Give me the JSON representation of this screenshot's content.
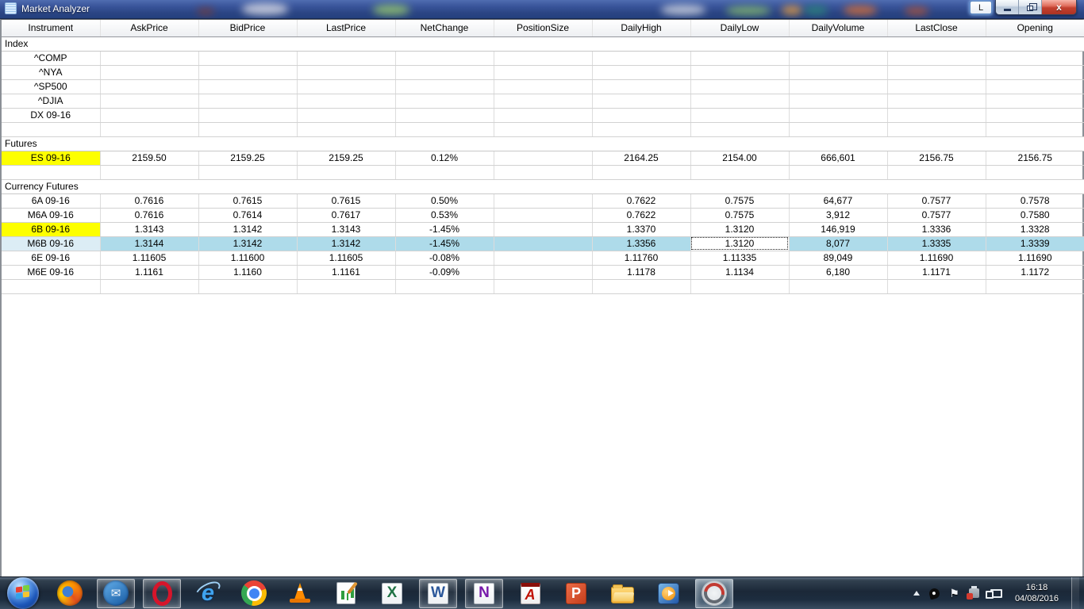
{
  "window": {
    "title": "Market Analyzer",
    "l_button_label": "L",
    "close_glyph": "x"
  },
  "colors": {
    "highlight_yellow": "#fdff00",
    "selected_row": "#aedbea",
    "selected_instrument": "#dcedf5",
    "titlebar_blue": "#33518f"
  },
  "table": {
    "columns": [
      "Instrument",
      "AskPrice",
      "BidPrice",
      "LastPrice",
      "NetChange",
      "PositionSize",
      "DailyHigh",
      "DailyLow",
      "DailyVolume",
      "LastClose",
      "Opening"
    ],
    "groups": [
      {
        "label": "Index",
        "rows": [
          {
            "instrument": "^COMP",
            "cells": [
              "",
              "",
              "",
              "",
              "",
              "",
              "",
              "",
              "",
              ""
            ]
          },
          {
            "instrument": "^NYA",
            "cells": [
              "",
              "",
              "",
              "",
              "",
              "",
              "",
              "",
              "",
              ""
            ]
          },
          {
            "instrument": "^SP500",
            "cells": [
              "",
              "",
              "",
              "",
              "",
              "",
              "",
              "",
              "",
              ""
            ]
          },
          {
            "instrument": "^DJIA",
            "cells": [
              "",
              "",
              "",
              "",
              "",
              "",
              "",
              "",
              "",
              ""
            ]
          },
          {
            "instrument": "DX 09-16",
            "cells": [
              "",
              "",
              "",
              "",
              "",
              "",
              "",
              "",
              "",
              ""
            ]
          },
          {
            "instrument": "",
            "cells": [
              "",
              "",
              "",
              "",
              "",
              "",
              "",
              "",
              "",
              ""
            ]
          }
        ]
      },
      {
        "label": "Futures",
        "rows": [
          {
            "instrument": "ES 09-16",
            "highlight": "yellow",
            "cells": [
              "2159.50",
              "2159.25",
              "2159.25",
              "0.12%",
              "",
              "2164.25",
              "2154.00",
              "666,601",
              "2156.75",
              "2156.75"
            ]
          },
          {
            "instrument": "",
            "cells": [
              "",
              "",
              "",
              "",
              "",
              "",
              "",
              "",
              "",
              ""
            ]
          }
        ]
      },
      {
        "label": "Currency Futures",
        "rows": [
          {
            "instrument": "6A 09-16",
            "cells": [
              "0.7616",
              "0.7615",
              "0.7615",
              "0.50%",
              "",
              "0.7622",
              "0.7575",
              "64,677",
              "0.7577",
              "0.7578"
            ]
          },
          {
            "instrument": "M6A 09-16",
            "cells": [
              "0.7616",
              "0.7614",
              "0.7617",
              "0.53%",
              "",
              "0.7622",
              "0.7575",
              "3,912",
              "0.7577",
              "0.7580"
            ]
          },
          {
            "instrument": "6B 09-16",
            "highlight": "yellow",
            "cells": [
              "1.3143",
              "1.3142",
              "1.3143",
              "-1.45%",
              "",
              "1.3370",
              "1.3120",
              "146,919",
              "1.3336",
              "1.3328"
            ]
          },
          {
            "instrument": "M6B 09-16",
            "selected": true,
            "focus_index": 6,
            "cells": [
              "1.3144",
              "1.3142",
              "1.3142",
              "-1.45%",
              "",
              "1.3356",
              "1.3120",
              "8,077",
              "1.3335",
              "1.3339"
            ]
          },
          {
            "instrument": "6E 09-16",
            "cells": [
              "1.11605",
              "1.11600",
              "1.11605",
              "-0.08%",
              "",
              "1.11760",
              "1.11335",
              "89,049",
              "1.11690",
              "1.11690"
            ]
          },
          {
            "instrument": "M6E 09-16",
            "cells": [
              "1.1161",
              "1.1160",
              "1.1161",
              "-0.09%",
              "",
              "1.1178",
              "1.1134",
              "6,180",
              "1.1171",
              "1.1172"
            ]
          },
          {
            "instrument": "",
            "cells": [
              "",
              "",
              "",
              "",
              "",
              "",
              "",
              "",
              "",
              ""
            ]
          }
        ]
      }
    ]
  },
  "taskbar": {
    "items": [
      {
        "name": "start",
        "label": "Start"
      },
      {
        "name": "firefox",
        "label": "Firefox"
      },
      {
        "name": "thunderbird",
        "label": "Thunderbird",
        "open": true
      },
      {
        "name": "opera",
        "label": "Opera",
        "open": true
      },
      {
        "name": "internet-explorer",
        "label": "Internet Explorer"
      },
      {
        "name": "chrome",
        "label": "Google Chrome"
      },
      {
        "name": "vlc",
        "label": "VLC Media Player"
      },
      {
        "name": "notepad-editor",
        "label": "Notepad Editor"
      },
      {
        "name": "excel",
        "label": "Microsoft Excel"
      },
      {
        "name": "word",
        "label": "Microsoft Word",
        "open": true
      },
      {
        "name": "onenote",
        "label": "Microsoft OneNote",
        "open": true
      },
      {
        "name": "acrobat",
        "label": "Adobe Reader"
      },
      {
        "name": "powerpoint",
        "label": "Microsoft PowerPoint"
      },
      {
        "name": "explorer",
        "label": "Windows Explorer"
      },
      {
        "name": "media-player",
        "label": "Windows Media Player"
      },
      {
        "name": "ninjatrader",
        "label": "NinjaTrader",
        "open": true,
        "active": true
      }
    ]
  },
  "tray": {
    "time": "16:18",
    "date": "04/08/2016"
  }
}
